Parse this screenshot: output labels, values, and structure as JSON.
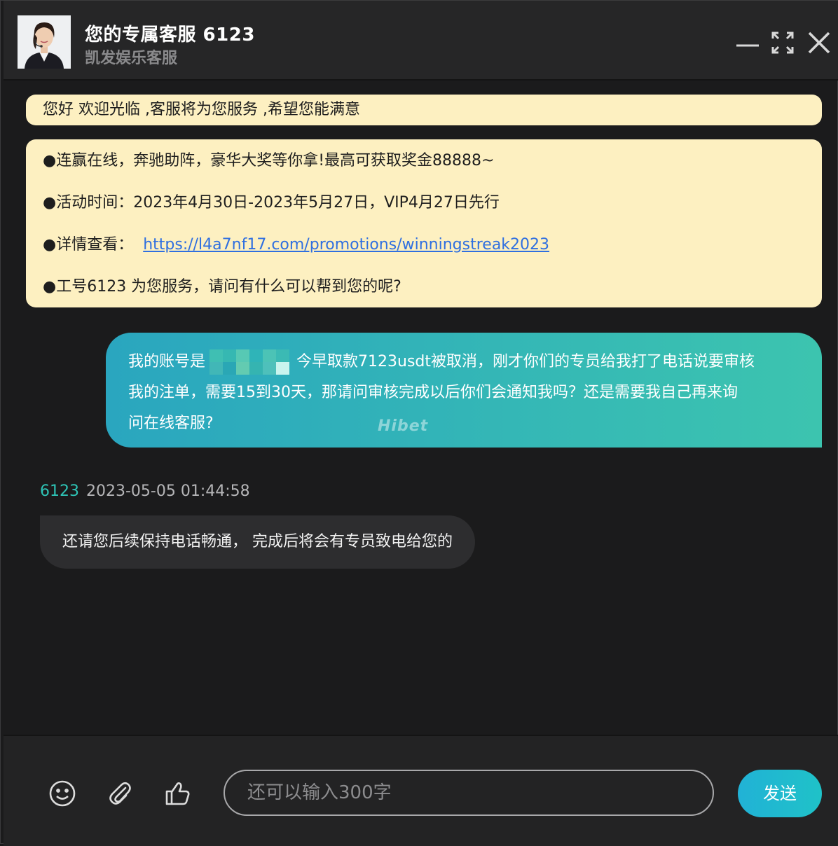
{
  "header": {
    "title": "您的专属客服 6123",
    "subtitle": "凯发娱乐客服"
  },
  "welcome": "您好 欢迎光临 ,客服将为您服务 ,希望您能满意",
  "promo": {
    "line1": "●连赢在线，奔驰助阵，豪华大奖等你拿!最高可获取奖金88888~",
    "line2": "●活动时间：2023年4月30日-2023年5月27日，VIP4月27日先行",
    "line3_label": "●详情查看：",
    "line3_link": "https://l4a7nf17.com/promotions/winningstreak2023",
    "line4": "●工号6123 为您服务，请问有什么可以帮到您的呢?"
  },
  "user_message": {
    "part1": "我的账号是",
    "part2": "今早取款7123usdt被取消，刚才你们的专员给我打了电话说要审核",
    "line2": "我的注单，需要15到30天，那请问审核完成以后你们会通知我吗？还是需要我自己再来询",
    "line3": "问在线客服?",
    "watermark": "Hibet"
  },
  "agent_message": {
    "agent_id": "6123",
    "timestamp": "2023-05-05 01:44:58",
    "text": "还请您后续保持电话畅通， 完成后将会有专员致电给您的"
  },
  "footer": {
    "input_placeholder": "还可以输入300字",
    "send_label": "发送"
  },
  "icons": {
    "minimize": "minimize-icon",
    "maximize": "maximize-icon",
    "close": "close-icon",
    "emoji": "emoji-icon",
    "attach": "paperclip-icon",
    "like": "thumbs-up-icon"
  },
  "colors": {
    "accent": "#2ec4b6",
    "promo_bg": "#fdf0c1",
    "link": "#2f6fe0",
    "send_button": "#21b2d6"
  }
}
